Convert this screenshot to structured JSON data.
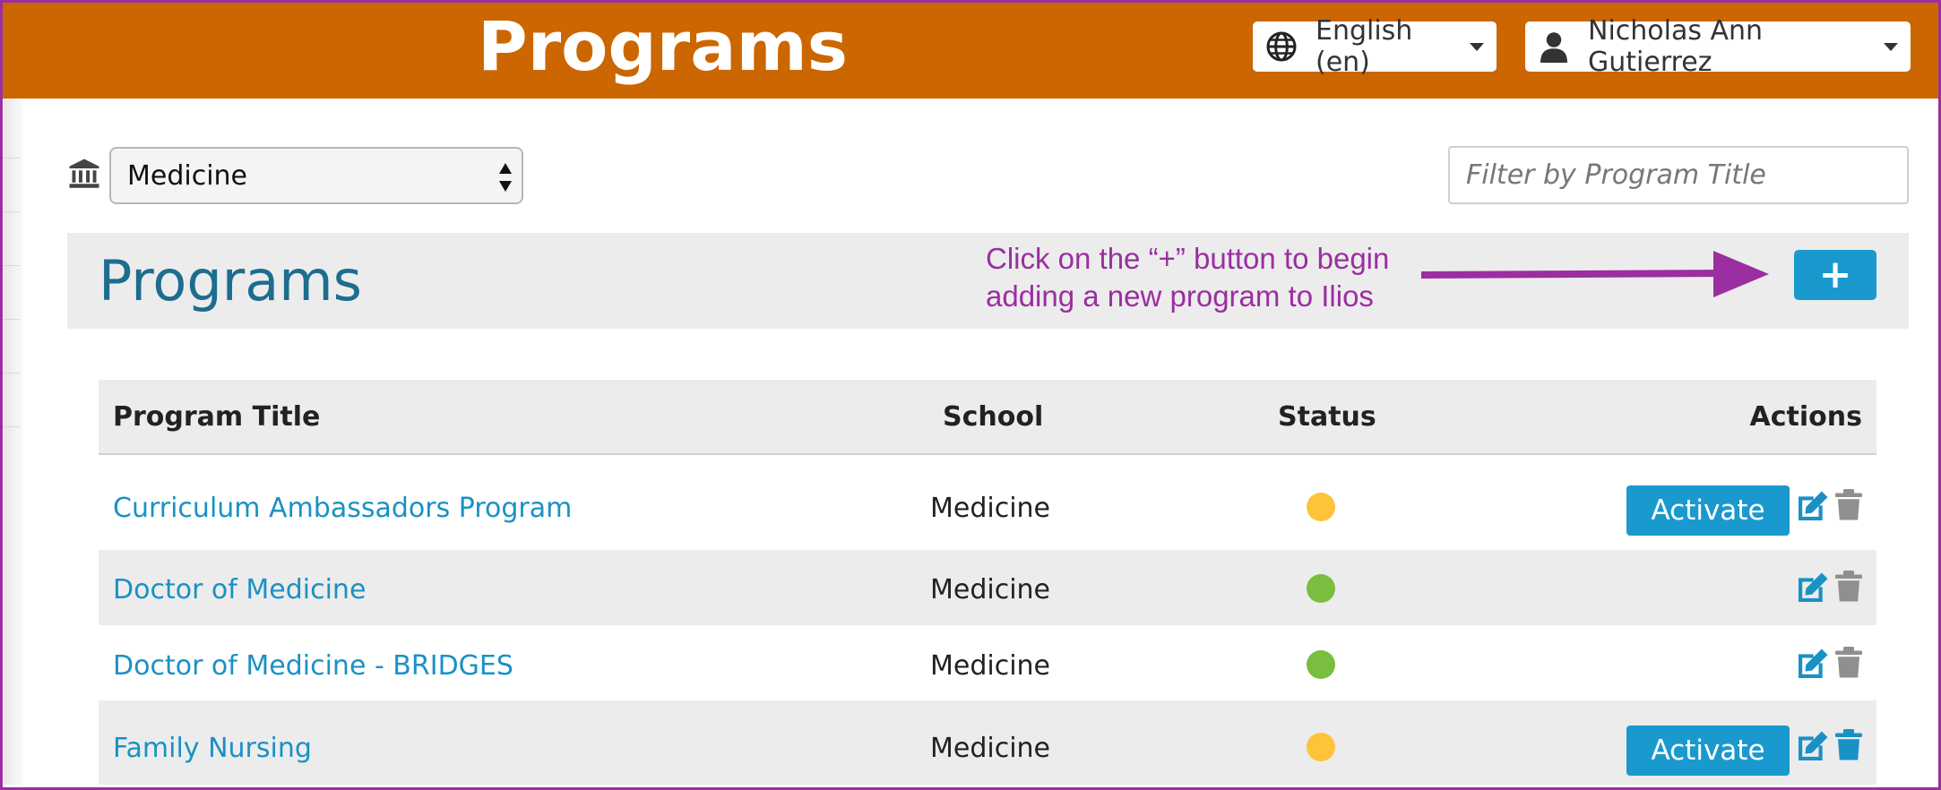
{
  "header": {
    "title": "Programs",
    "language": "English (en)",
    "user": "Nicholas Ann Gutierrez",
    "bar_color": "#cc6600"
  },
  "toolbar": {
    "school_selected": "Medicine",
    "filter_placeholder": "Filter by Program Title"
  },
  "panel": {
    "title": "Programs",
    "add_label": "+",
    "annotation": "Click on the “+” button to begin adding a new program to Ilios",
    "annotation_color": "#9b2ea0"
  },
  "table": {
    "columns": [
      "Program Title",
      "School",
      "Status",
      "Actions"
    ],
    "rows": [
      {
        "title": "Curriculum Ambassadors Program",
        "school": "Medicine",
        "status": "inactive",
        "action": "Activate"
      },
      {
        "title": "Doctor of Medicine",
        "school": "Medicine",
        "status": "active",
        "action": ""
      },
      {
        "title": "Doctor of Medicine - BRIDGES",
        "school": "Medicine",
        "status": "active",
        "action": ""
      },
      {
        "title": "Family Nursing",
        "school": "Medicine",
        "status": "inactive",
        "action": "Activate"
      }
    ]
  },
  "colors": {
    "status_active": "#79be3f",
    "status_inactive": "#fdc43a",
    "primary_button": "#1a99cf",
    "link": "#1a91c5"
  },
  "icons": [
    "globe-icon",
    "user-icon",
    "institution-icon",
    "edit-icon",
    "trash-icon"
  ]
}
